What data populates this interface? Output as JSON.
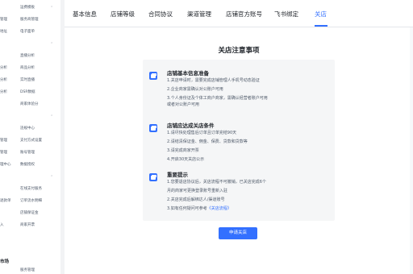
{
  "sidebar": {
    "rows": [
      {
        "c1": "",
        "c2": "运费模板",
        "chev": false
      },
      {
        "c1": "管理",
        "c2": "服务商管理",
        "chev": false
      },
      {
        "c1": "地址",
        "c2": "电子面单",
        "chev": false
      },
      {
        "c1": "",
        "c2": "",
        "chev": true
      },
      {
        "c1": "",
        "c2": "直播分析",
        "chev": false
      },
      {
        "c1": "分析",
        "c2": "商品分析",
        "chev": false
      },
      {
        "c1": "分析",
        "c2": "实时直播",
        "chev": false
      },
      {
        "c1": "分析",
        "c2": "DSR数据",
        "chev": false
      },
      {
        "c1": "",
        "c2": "商家体验分",
        "chev": false
      },
      {
        "c1": "",
        "c2": "",
        "chev": true
      },
      {
        "c1": "",
        "c2": "违规中心",
        "chev": false
      },
      {
        "c1": "管理",
        "c2": "支付方式设置",
        "chev": false
      },
      {
        "c1": "管理",
        "c2": "账号管理",
        "chev": false
      },
      {
        "c1": "理中心",
        "c2": "数据授权",
        "chev": false
      },
      {
        "c1": "",
        "c2": "",
        "chev": true
      },
      {
        "c1": "",
        "c2": "在线支付服务",
        "chev": false
      },
      {
        "c1": "退款单",
        "c2": "订单流水明细",
        "chev": false
      },
      {
        "c1": "",
        "c2": "店铺保证金",
        "chev": false
      },
      {
        "c1": "入",
        "c2": "商家开票",
        "chev": false
      }
    ],
    "bottom_heading": "市场",
    "bottom_row": {
      "c1": "",
      "c2": "服务管理"
    }
  },
  "tabs": [
    {
      "label": "基本信息",
      "active": false
    },
    {
      "label": "店铺等级",
      "active": false
    },
    {
      "label": "合同协议",
      "active": false
    },
    {
      "label": "渠道管理",
      "active": false
    },
    {
      "label": "店铺官方账号",
      "active": false
    },
    {
      "label": "飞书绑定",
      "active": false
    },
    {
      "label": "关店",
      "active": true
    }
  ],
  "notice": {
    "title": "关店注意事项",
    "sections": [
      {
        "title": "店铺基本信息准备",
        "icon": "briefcase-icon",
        "lines": [
          "1.关店申请时，需要完成店铺管理人手机号动态验证",
          "2.企业商家需确认对公账户可用",
          "3.个人身份证及个体工商户商家，需确认经营者账户可用",
          "或者对公账户可用"
        ]
      },
      {
        "title": "店铺应达成关店条件",
        "icon": "briefcase-icon",
        "lines": [
          "1.请尽快处理售后订单且订单完结90天",
          "2.请结清保证金、佣金、保费、贷款和贷款等",
          "3.请完成商家开票",
          "4.开启30天关店公示"
        ]
      },
      {
        "title": "重要提示",
        "icon": "briefcase-icon",
        "lines": [
          "1.您要退店协议后，关店流程不可撤销，已关店完成6个",
          "月的商家可更换登录账号重新入驻",
          "2.关店完成后解绑达人/渠道账号"
        ],
        "last_line_prefix": "3.如有任何疑问可参考",
        "last_line_link": "《关店流程》"
      }
    ]
  },
  "apply_button": "申请关店",
  "colors": {
    "accent": "#3370ff",
    "card_bg": "#f5f6f7",
    "text": "#1f2329",
    "muted": "#4e5969"
  }
}
